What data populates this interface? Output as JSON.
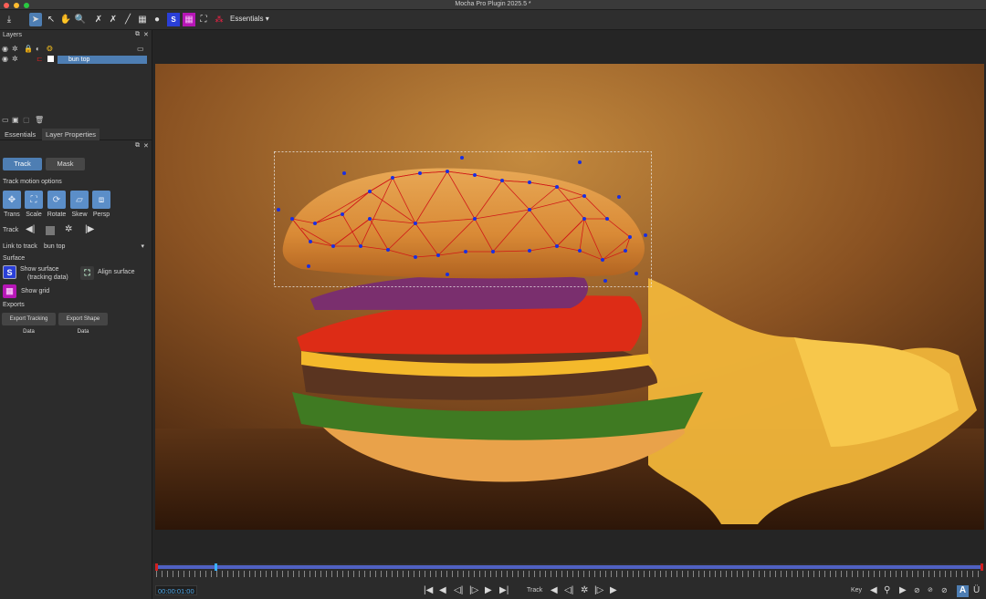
{
  "window": {
    "title": "Mocha Pro Plugin 2025.5 *"
  },
  "toolbar": {
    "workspace": "Essentials",
    "workspace_icon": "chevron-down-icon"
  },
  "layers_panel": {
    "header": "Layers",
    "layers": [
      {
        "name": "bun top"
      }
    ]
  },
  "tabs": [
    {
      "label": "Essentials"
    },
    {
      "label": "Layer Properties"
    }
  ],
  "essentials": {
    "mode_buttons": {
      "track": "Track",
      "mask": "Mask"
    },
    "track_motion_options": "Track motion options",
    "motion_options": [
      {
        "label": "Trans",
        "icon": "translate-icon"
      },
      {
        "label": "Scale",
        "icon": "scale-icon"
      },
      {
        "label": "Rotate",
        "icon": "rotate-icon"
      },
      {
        "label": "Skew",
        "icon": "skew-icon"
      },
      {
        "label": "Persp",
        "icon": "perspective-icon"
      }
    ],
    "track_label": "Track",
    "link_to_track_label": "Link to track",
    "link_to_track_value": "bun top",
    "surface_header": "Surface",
    "show_surface_line1": "Show surface",
    "show_surface_line2": "(tracking data)",
    "align_surface": "Align surface",
    "show_grid": "Show grid",
    "exports_header": "Exports",
    "export_tracking": "Export Tracking Data",
    "export_shape": "Export Shape Data"
  },
  "timeline": {
    "timecode": "00:00:01:00",
    "track_label": "Track",
    "key_label": "Key"
  },
  "colors": {
    "accent": "#4e7eb3",
    "timecode": "#4ea6e6",
    "spline": "#d01818",
    "points": "#1a2fe0"
  }
}
